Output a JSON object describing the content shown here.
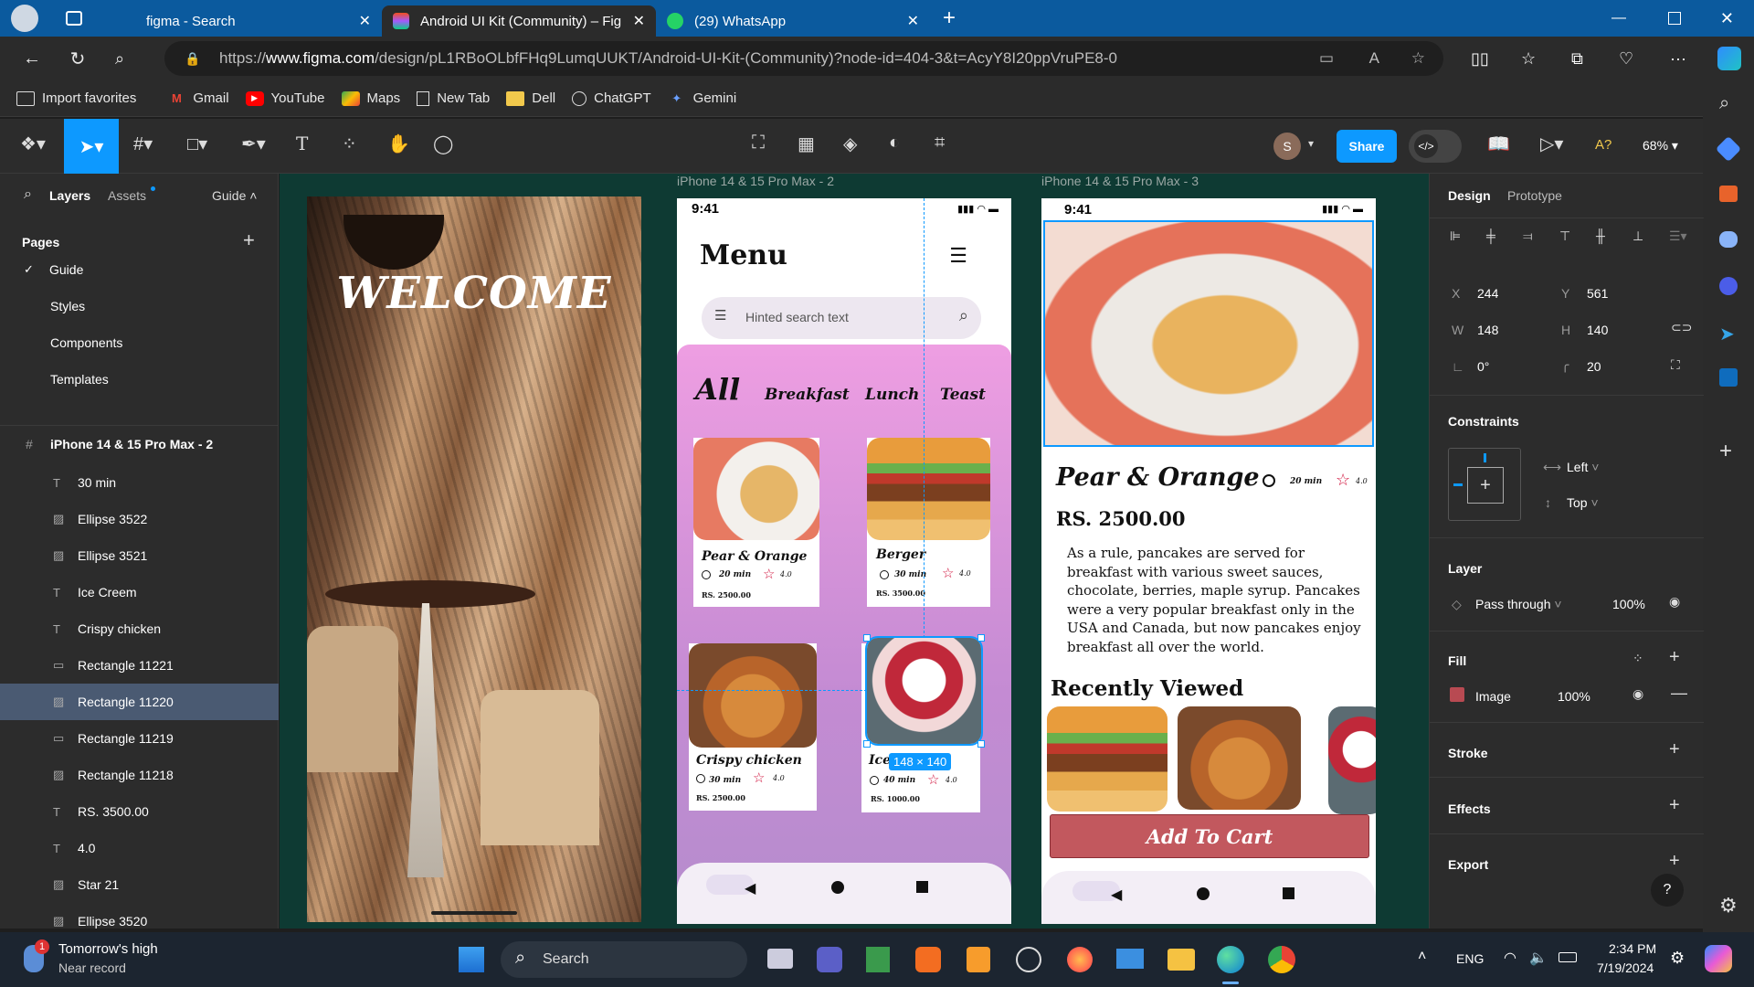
{
  "browser": {
    "tabs": [
      {
        "label": "figma - Search"
      },
      {
        "label": "Android UI Kit (Community) – Fig"
      },
      {
        "label": "(29) WhatsApp"
      }
    ],
    "url_prefix": "https://",
    "url_domain": "www.figma.com",
    "url_path": "/design/pL1RBoOLbfFHq9LumqUUKT/Android-UI-Kit-(Community)?node-id=404-3&t=AcyY8I20ppVruPE8-0",
    "favorites": [
      "Import favorites",
      "Gmail",
      "YouTube",
      "Maps",
      "New Tab",
      "Dell",
      "ChatGPT",
      "Gemini"
    ]
  },
  "figma": {
    "toolbar": {
      "avatar": "S",
      "share": "Share",
      "zoom": "68%"
    },
    "left": {
      "tabs": {
        "layers": "Layers",
        "assets": "Assets",
        "guide": "Guide"
      },
      "pages_title": "Pages",
      "pages": [
        "Guide",
        "Styles",
        "Components",
        "Templates"
      ],
      "frame": "iPhone 14 & 15 Pro Max - 2",
      "layers": [
        "30 min",
        "Ellipse 3522",
        "Ellipse 3521",
        "Ice Creem",
        "Crispy chicken",
        "Rectangle 11221",
        "Rectangle 11220",
        "Rectangle 11219",
        "Rectangle 11218",
        "RS. 3500.00",
        "4.0",
        "Star 21",
        "Ellipse 3520"
      ]
    },
    "right": {
      "tabs": {
        "design": "Design",
        "prototype": "Prototype"
      },
      "x_label": "X",
      "x": "244",
      "y_label": "Y",
      "y": "561",
      "w_label": "W",
      "w": "148",
      "h_label": "H",
      "h": "140",
      "rotation": "0°",
      "radius": "20",
      "constraints": "Constraints",
      "c_left": "Left",
      "c_top": "Top",
      "layer": "Layer",
      "blend": "Pass through",
      "opacity": "100%",
      "fill": "Fill",
      "fill_type": "Image",
      "fill_opacity": "100%",
      "stroke": "Stroke",
      "effects": "Effects",
      "export": "Export"
    },
    "canvas": {
      "frame2_label": "iPhone 14 & 15 Pro Max - 2",
      "frame3_label": "iPhone 14 & 15 Pro Max - 3",
      "welcome": "WELCOME",
      "time": "9:41",
      "menu_title": "Menu",
      "search_placeholder": "Hinted search text",
      "categories": [
        "All",
        "Breakfast",
        "Lunch",
        "Teast"
      ],
      "cards": [
        {
          "name": "Pear & Orange",
          "time": "20 min",
          "rating": "4.0",
          "price": "RS. 2500.00"
        },
        {
          "name": "Berger",
          "time": "30 min",
          "rating": "4.0",
          "price": "RS. 3500.00"
        },
        {
          "name": "Crispy chicken",
          "time": "30 min",
          "rating": "4.0",
          "price": "RS. 2500.00"
        },
        {
          "name": "Ice Cream",
          "time": "40 min",
          "rating": "4.0",
          "price": "RS. 1000.00"
        }
      ],
      "size_badge": "148 × 140",
      "detail": {
        "title": "Pear & Orange",
        "time": "20 min",
        "rating": "4.0",
        "price": "RS. 2500.00",
        "description": "As a rule, pancakes are served for breakfast with various sweet sauces, chocolate, berries, maple syrup. Pancakes were a very popular breakfast only in the USA and Canada, but now pancakes enjoy breakfast all over the world.",
        "recent": "Recently Viewed",
        "cta": "Add To Cart"
      }
    }
  },
  "taskbar": {
    "weather_title": "Tomorrow's high",
    "weather_sub": "Near record",
    "search": "Search",
    "lang": "ENG",
    "time": "2:34 PM",
    "date": "7/19/2024"
  }
}
